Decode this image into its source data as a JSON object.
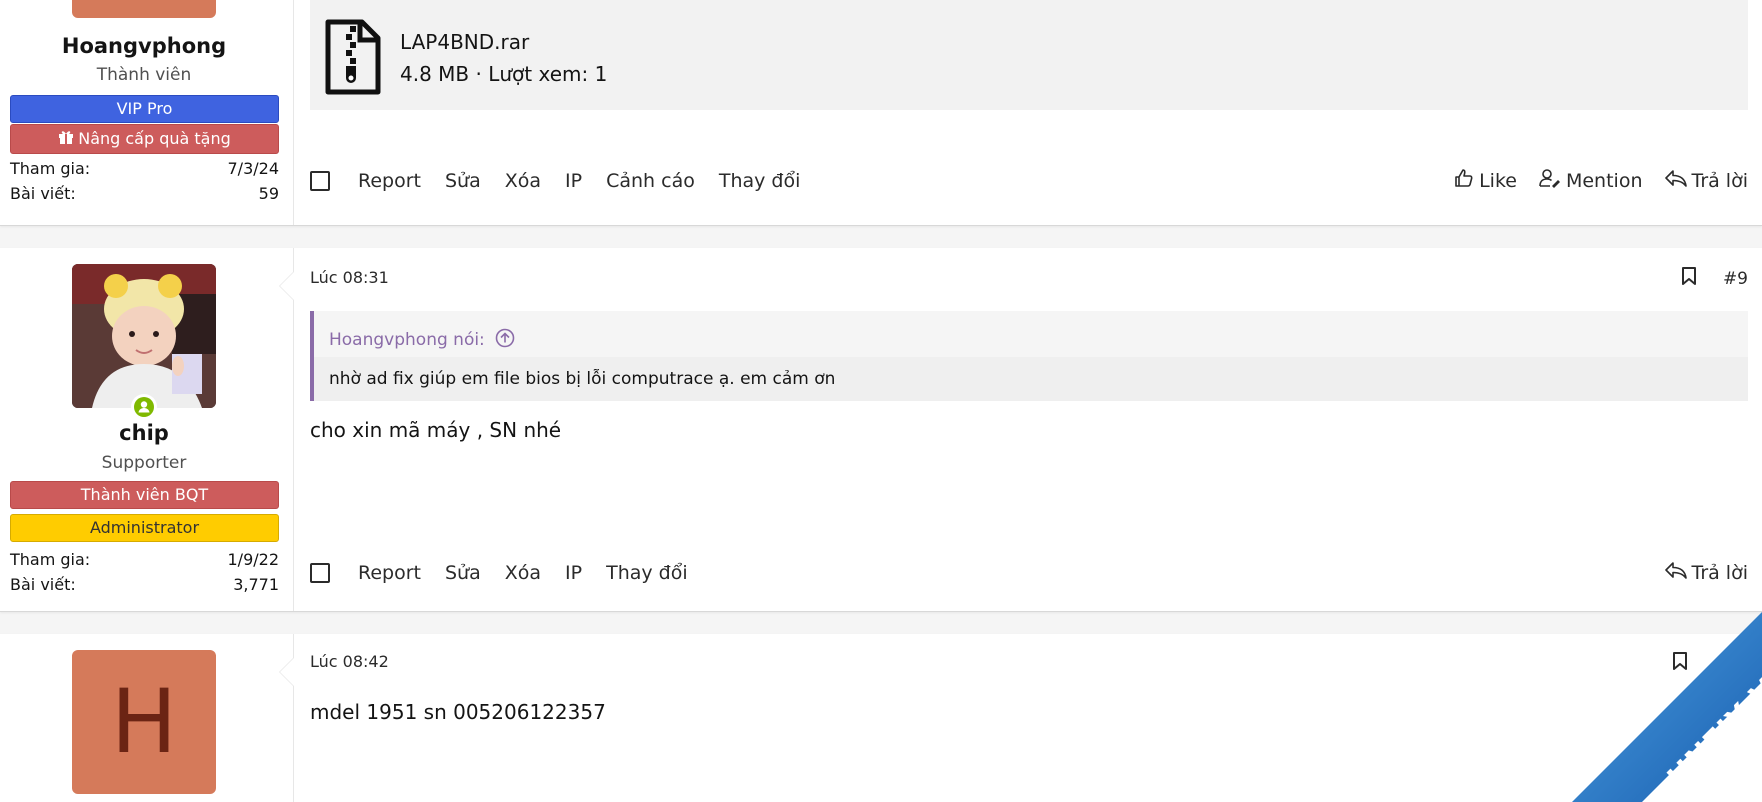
{
  "post1": {
    "username": "Hoangvphong",
    "user_title": "Thành viên",
    "banners": [
      "VIP Pro",
      "Nâng cấp quà tặng"
    ],
    "stats": [
      {
        "label": "Tham gia:",
        "value": "7/3/24"
      },
      {
        "label": "Bài viết:",
        "value": "59"
      }
    ],
    "attachment": {
      "name": "LAP4BND.rar",
      "meta": "4.8 MB · Lượt xem: 1",
      "icon": "zip-file-icon"
    },
    "actions_left": [
      "Report",
      "Sửa",
      "Xóa",
      "IP",
      "Cảnh cáo",
      "Thay đổi"
    ],
    "actions_right": [
      "Like",
      "Mention",
      "Trả lời"
    ]
  },
  "post2": {
    "username": "chip",
    "user_title": "Supporter",
    "banners": [
      "Thành viên BQT",
      "Administrator"
    ],
    "stats": [
      {
        "label": "Tham gia:",
        "value": "1/9/22"
      },
      {
        "label": "Bài viết:",
        "value": "3,771"
      }
    ],
    "time": "Lúc 08:31",
    "number": "#9",
    "quote": {
      "author": "Hoangvphong nói:",
      "text": "nhờ ad fix giúp em file bios bị lỗi computrace ạ. em cảm ơn"
    },
    "body": "cho xin mã máy , SN nhé",
    "actions_left": [
      "Report",
      "Sửa",
      "Xóa",
      "IP",
      "Thay đổi"
    ],
    "actions_right": [
      "Trả lời"
    ]
  },
  "post3": {
    "avatar_letter": "H",
    "time": "Lúc 08:42",
    "body": "mdel 1951 sn 005206122357"
  },
  "watermark": {
    "text": "HNFIX.VN"
  },
  "colors": {
    "vip_blue": "#3f63e0",
    "bqt_red": "#cd5c5c",
    "admin_yellow": "#ffcc00",
    "quote_purple": "#8a6ba8",
    "online_green": "#7fb900",
    "avatar_orange": "#d57a5a"
  }
}
